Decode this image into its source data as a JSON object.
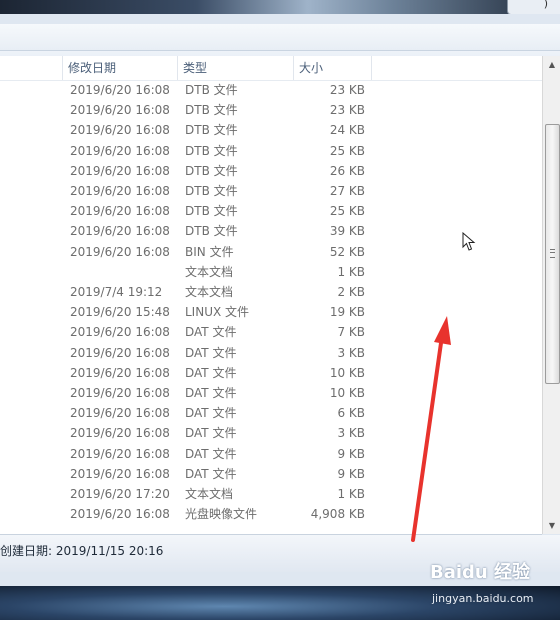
{
  "window": {
    "top_right_glyph": ")"
  },
  "columns": {
    "date_modified": "修改日期",
    "type": "类型",
    "size": "大小"
  },
  "rows": [
    {
      "date": "2019/6/20 16:08",
      "type": "DTB 文件",
      "size": "23 KB"
    },
    {
      "date": "2019/6/20 16:08",
      "type": "DTB 文件",
      "size": "23 KB"
    },
    {
      "date": "2019/6/20 16:08",
      "type": "DTB 文件",
      "size": "24 KB"
    },
    {
      "date": "2019/6/20 16:08",
      "type": "DTB 文件",
      "size": "25 KB"
    },
    {
      "date": "2019/6/20 16:08",
      "type": "DTB 文件",
      "size": "26 KB"
    },
    {
      "date": "2019/6/20 16:08",
      "type": "DTB 文件",
      "size": "27 KB"
    },
    {
      "date": "2019/6/20 16:08",
      "type": "DTB 文件",
      "size": "25 KB"
    },
    {
      "date": "2019/6/20 16:08",
      "type": "DTB 文件",
      "size": "39 KB"
    },
    {
      "date": "2019/6/20 16:08",
      "type": "BIN 文件",
      "size": "52 KB"
    },
    {
      "date": "",
      "type": "文本文档",
      "size": "1 KB"
    },
    {
      "date": "2019/7/4 19:12",
      "type": "文本文档",
      "size": "2 KB"
    },
    {
      "date": "2019/6/20 15:48",
      "type": "LINUX 文件",
      "size": "19 KB"
    },
    {
      "date": "2019/6/20 16:08",
      "type": "DAT 文件",
      "size": "7 KB"
    },
    {
      "date": "2019/6/20 16:08",
      "type": "DAT 文件",
      "size": "3 KB"
    },
    {
      "date": "2019/6/20 16:08",
      "type": "DAT 文件",
      "size": "10 KB"
    },
    {
      "date": "2019/6/20 16:08",
      "type": "DAT 文件",
      "size": "10 KB"
    },
    {
      "date": "2019/6/20 16:08",
      "type": "DAT 文件",
      "size": "6 KB"
    },
    {
      "date": "2019/6/20 16:08",
      "type": "DAT 文件",
      "size": "3 KB"
    },
    {
      "date": "2019/6/20 16:08",
      "type": "DAT 文件",
      "size": "9 KB"
    },
    {
      "date": "2019/6/20 16:08",
      "type": "DAT 文件",
      "size": "9 KB"
    },
    {
      "date": "2019/6/20 17:20",
      "type": "文本文档",
      "size": "1 KB"
    },
    {
      "date": "2019/6/20 16:08",
      "type": "光盘映像文件",
      "size": "4,908 KB"
    }
  ],
  "status_bar": {
    "created_label": "创建日期:",
    "created_value": "2019/11/15 20:16"
  },
  "watermark": {
    "logo": "Baidu 经验",
    "url": "jingyan.baidu.com"
  },
  "colors": {
    "annotation_arrow": "#e8332d",
    "scrollbar_track": "#f0f0f0"
  }
}
